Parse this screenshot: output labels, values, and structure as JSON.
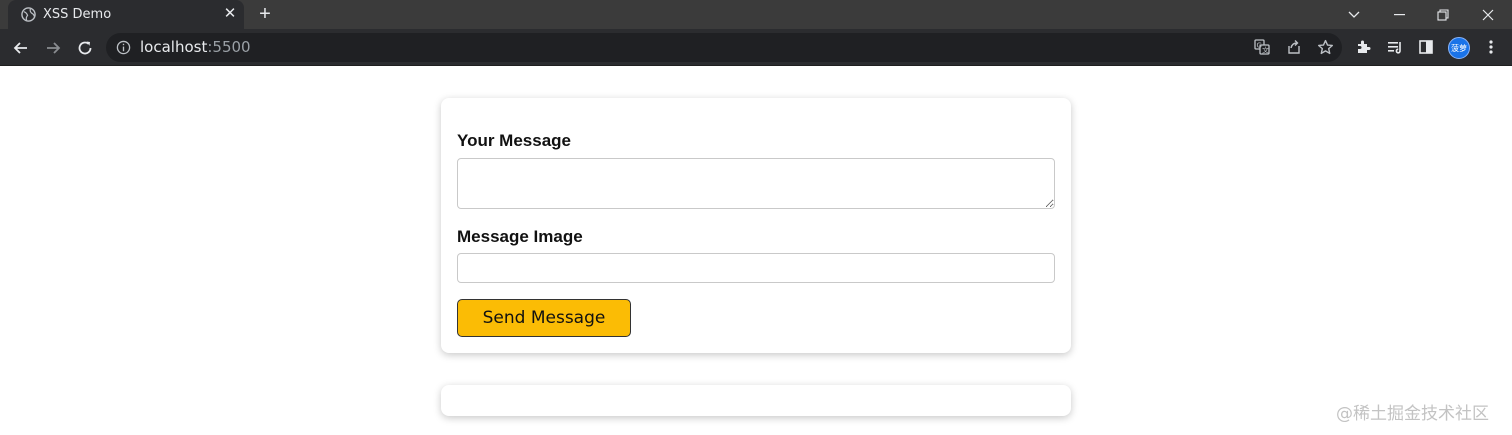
{
  "browser": {
    "tab_title": "XSS Demo",
    "url_host": "localhost",
    "url_port": ":5500",
    "avatar_text": "菠萝",
    "colors": {
      "chrome_bg": "#3b3b3b",
      "toolbar_bg": "#2b2c2f",
      "omnibox_bg": "#1f2023",
      "avatar": "#1a73e8"
    }
  },
  "form": {
    "message_label": "Your Message",
    "message_value": "",
    "image_label": "Message Image",
    "image_value": "",
    "send_label": "Send Message",
    "colors": {
      "send_button": "#fbbc05"
    }
  },
  "watermark": "@稀土掘金技术社区"
}
